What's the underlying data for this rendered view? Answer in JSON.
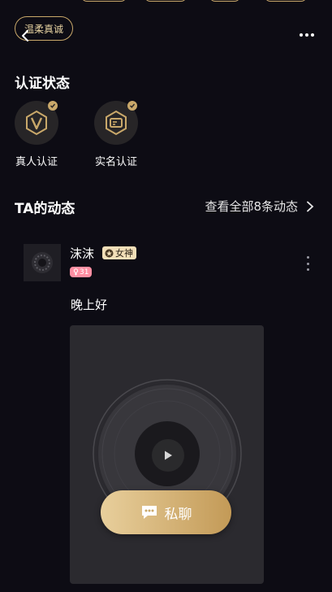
{
  "profile": {
    "tag": "温柔真诚"
  },
  "certification": {
    "title": "认证状态",
    "badges": [
      {
        "label": "真人认证",
        "icon": "v-badge-icon",
        "verified": true
      },
      {
        "label": "实名认证",
        "icon": "id-card-icon",
        "verified": true
      }
    ]
  },
  "moments": {
    "title": "TA的动态",
    "view_all": "查看全部8条动态",
    "post": {
      "username": "沫沫",
      "badge": "女神",
      "age": "31",
      "text": "晚上好"
    }
  },
  "actions": {
    "chat_label": "私聊"
  },
  "colors": {
    "background": "#0d0c14",
    "gold": "#c9a86a",
    "age_pink": "#ff8fa3"
  }
}
